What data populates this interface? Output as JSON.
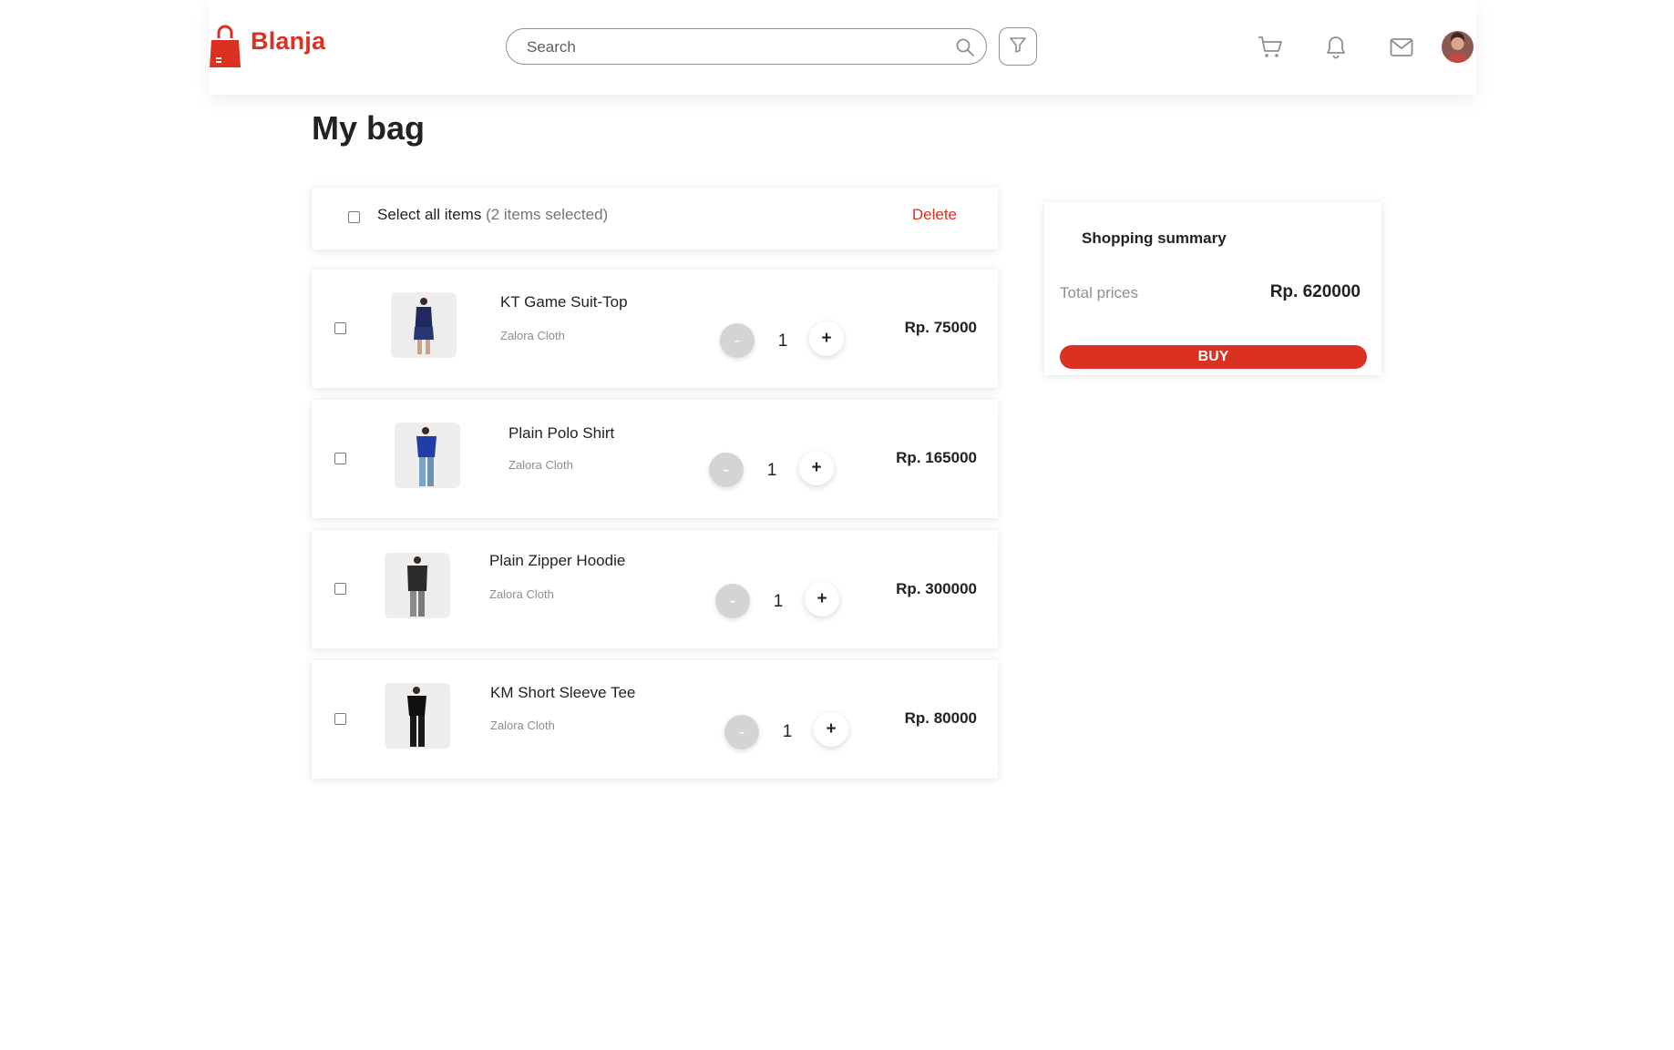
{
  "brand": {
    "name": "Blanja",
    "color": "#db3022"
  },
  "search": {
    "placeholder": "Search"
  },
  "header": {
    "icons": [
      "search-icon",
      "filter-icon",
      "cart-icon",
      "bell-icon",
      "mail-icon",
      "avatar"
    ]
  },
  "page": {
    "title": "My bag"
  },
  "select_all": {
    "label": "Select all items",
    "count_text": "(2 items selected)",
    "delete_label": "Delete"
  },
  "items": [
    {
      "name": "KT Game Suit-Top",
      "store": "Zalora Cloth",
      "qty": "1",
      "price": "Rp. 75000",
      "minus": "-",
      "plus": "+"
    },
    {
      "name": "Plain Polo Shirt",
      "store": "Zalora Cloth",
      "qty": "1",
      "price": "Rp. 165000",
      "minus": "-",
      "plus": "+"
    },
    {
      "name": "Plain Zipper Hoodie",
      "store": "Zalora Cloth",
      "qty": "1",
      "price": "Rp. 300000",
      "minus": "-",
      "plus": "+"
    },
    {
      "name": "KM Short Sleeve Tee",
      "store": "Zalora Cloth",
      "qty": "1",
      "price": "Rp. 80000",
      "minus": "-",
      "plus": "+"
    }
  ],
  "summary": {
    "title": "Shopping summary",
    "total_label": "Total prices",
    "total_value": "Rp. 620000",
    "buy_label": "BUY"
  }
}
